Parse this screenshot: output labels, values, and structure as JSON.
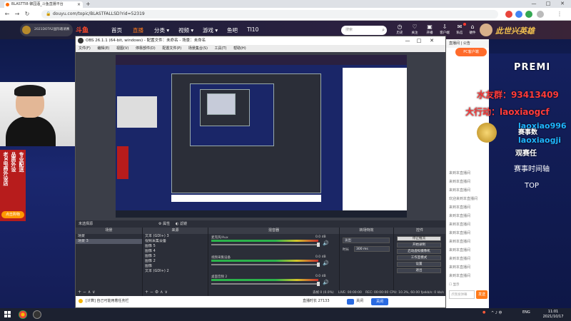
{
  "browser": {
    "tab_title": "BLASTTI8·御园酒_斗鱼直播平台",
    "url": "douyu.com/topic/BLASTFALLSD?rid=52319",
    "minimize": "—",
    "maximize": "□",
    "close": "✕",
    "new_tab": "+"
  },
  "douyu": {
    "logo_text": "2021DOTA2国际邀请赛",
    "brand": "斗鱼",
    "nav": [
      "首页",
      "直播",
      "分类 ▾",
      "视频 ▾",
      "游戏 ▾",
      "鱼吧",
      "TI10"
    ],
    "search_placeholder": "搜索",
    "top_icons": [
      "历史",
      "关注",
      "开播",
      "客户端",
      "私信",
      "硬件"
    ],
    "banner": "此世兴英雄"
  },
  "promo": {
    "col1": "老X电商外设店",
    "col2": "品质外设",
    "col3": "专业配送",
    "button": "点击购物"
  },
  "overlay": {
    "line1": "水友群：93413409",
    "line2": "大行动：laoxiaogcf",
    "line3": "laoxiao996",
    "line4": "laoxiaogji",
    "line5": "观赛任",
    "line6": "赛事数",
    "schedule": "赛事时间轴",
    "top": "TOP",
    "prem": "PREMI"
  },
  "obs": {
    "title": "OBS 26.1.1 (64-bit, windows) - 配置文件：未命名 - 场景：未命名",
    "menu": [
      "文件(F)",
      "编辑(E)",
      "视图(V)",
      "停靠部件(D)",
      "配置文件(P)",
      "场景集合(S)",
      "工具(T)",
      "帮助(H)"
    ],
    "bar_label": "未选择源",
    "bar_props": "⚙ 属性",
    "bar_filters": "◐ 滤镜",
    "docks": {
      "scenes": "场景",
      "sources": "来源",
      "mixer": "混音器",
      "transitions": "转场特效",
      "controls": "控件"
    },
    "scenes": [
      "场景",
      "场景 3"
    ],
    "sources": [
      "文本 (GDI+) 3",
      "视频采集设备",
      "图像 5",
      "图像 4",
      "图像 3",
      "图像 2",
      "图像",
      "文本 (GDI+) 2"
    ],
    "mixer": [
      {
        "name": "麦克风/Aux",
        "db": "0.0 dB"
      },
      {
        "name": "视频采集设备",
        "db": "0.0 dB"
      },
      {
        "name": "桌面音频 2",
        "db": "0.0 dB"
      }
    ],
    "transition": {
      "type": "淡出",
      "duration_label": "时长",
      "duration": "300 ms"
    },
    "controls": [
      "停止推流",
      "开始录制",
      "启动虚拟摄像机",
      "工作室模式",
      "设置",
      "退出"
    ],
    "status": {
      "drop": "丢帧 0 (0.0%)",
      "live": "LIVE: 00:00:00",
      "rec": "REC: 00:00:00",
      "cpu": "CPU: 10.3%, 60.00 fps",
      "kbps": "kb/s: 0 kb/s"
    }
  },
  "statusline": {
    "left": "[计算] 自己可能用着任务栏",
    "mid": "直播时长 27133",
    "stop": "关闭",
    "close": "关闭"
  },
  "chat": {
    "header": "直播间 | 公告",
    "lines": [
      "来到本直播间",
      "欢迎来到本直播间",
      "来到本直播间",
      "来到本直播间",
      "来到本直播间",
      "来到本直播间",
      "来到本直播间",
      "来到本直播间",
      "来到本直播间",
      "来到本直播间",
      "来到本直播间",
      "来到本直播间",
      "来到本直播间"
    ],
    "checkbox": "☐ 显示",
    "input_placeholder": "点我发弹幕",
    "send": "发送",
    "gift_btn": "PC客户端"
  },
  "taskbar": {
    "tray_icons": "^ ♪ 中",
    "lang": "ENG",
    "time": "11:01",
    "date": "2021/10/17"
  },
  "colors": {
    "accent": "#ff7a1a",
    "obs_bg": "#2b2e38",
    "stream_bg": "#1a2770",
    "overlay_red": "#ff3b3b"
  }
}
